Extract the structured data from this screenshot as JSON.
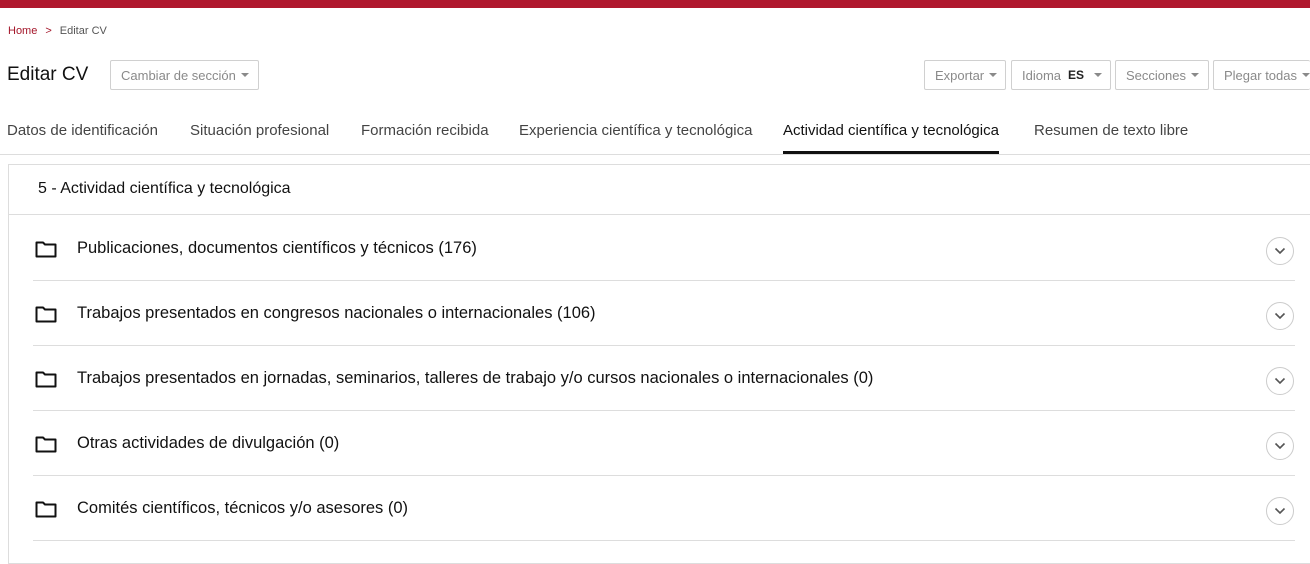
{
  "breadcrumb": {
    "home": "Home",
    "separator": ">",
    "current": "Editar CV"
  },
  "page_title": "Editar CV",
  "toolbar": {
    "section_switch": "Cambiar de sección",
    "export": "Exportar",
    "language_label": "Idioma",
    "language_value": "ES",
    "sections": "Secciones",
    "collapse_all": "Plegar todas"
  },
  "tabs": [
    {
      "label": "Datos de identificación"
    },
    {
      "label": "Situación profesional"
    },
    {
      "label": "Formación recibida"
    },
    {
      "label": "Experiencia científica y tecnológica"
    },
    {
      "label": "Actividad científica y tecnológica",
      "active": true
    },
    {
      "label": "Resumen de texto libre"
    }
  ],
  "section": {
    "title": "5 - Actividad científica y tecnológica",
    "items": [
      {
        "label": "Publicaciones, documentos científicos y técnicos (176)"
      },
      {
        "label": "Trabajos presentados en congresos nacionales o internacionales (106)"
      },
      {
        "label": "Trabajos presentados en jornadas, seminarios, talleres de trabajo y/o cursos nacionales o internacionales (0)"
      },
      {
        "label": "Otras actividades de divulgación (0)"
      },
      {
        "label": "Comités científicos, técnicos y/o asesores (0)"
      }
    ]
  },
  "colors": {
    "brand": "#b0182e",
    "active_tab_underline": "#111111"
  },
  "icons": {
    "item": "folder-icon",
    "toggle": "chevron-down-icon",
    "dropdown": "caret-down-icon"
  }
}
